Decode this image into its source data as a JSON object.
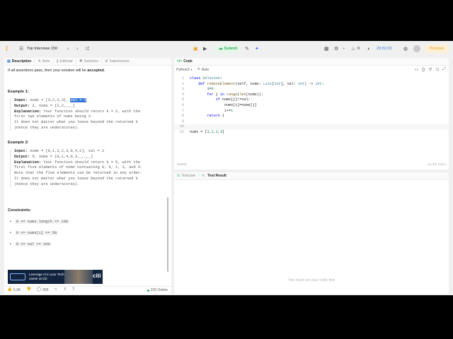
{
  "topnav": {
    "list_title": "Top Interview 150",
    "submit_label": "Submit",
    "fire_count": "0",
    "timer": "29:52:23",
    "premium_label": "Premium"
  },
  "left": {
    "tabs": [
      {
        "label": "Description"
      },
      {
        "label": "Note"
      },
      {
        "label": "Editorial"
      },
      {
        "label": "Solutions"
      },
      {
        "label": "Submissions"
      }
    ],
    "intro_text": "If all assertions pass, then your solution will be ",
    "intro_bold": "accepted",
    "intro_end": ".",
    "example1": {
      "title": "Example 1:",
      "input_label": "Input:",
      "input_value": " nums = [3,2,2,3], ",
      "input_hl": "val = 3",
      "output_label": "Output:",
      "output_value": " 2, nums = [2,2,_,_]",
      "explanation_label": "Explanation:",
      "explanation_lines": [
        " Your function should return k = 2, with the",
        "first two elements of nums being 2.",
        "It does not matter what you leave beyond the returned k",
        "(hence they are underscores)."
      ]
    },
    "example2": {
      "title": "Example 2:",
      "input_label": "Input:",
      "input_value": " nums = [0,1,2,2,3,0,4,2], val = 2",
      "output_label": "Output:",
      "output_value": " 5, nums = [0,1,4,0,3,_,_,_]",
      "explanation_label": "Explanation:",
      "explanation_lines": [
        " Your function should return k = 5, with the",
        "first five elements of nums containing 0, 0, 1, 3, and 4.",
        "Note that the five elements can be returned in any order.",
        "It does not matter what you leave beyond the returned k",
        "(hence they are underscores)."
      ]
    },
    "constraints_title": "Constraints:",
    "constraints": [
      "0 <= nums.length <= 100",
      "0 <= nums[i] <= 50",
      "0 <= val <= 100"
    ],
    "ad": {
      "text": "Leverage AI in your Tech career at Citi",
      "logo": "citi"
    },
    "footer": {
      "likes": "5.2K",
      "comments": "955",
      "online": "220 Online"
    }
  },
  "editor": {
    "title": "Code",
    "language": "Python3",
    "auto_label": "Auto",
    "lines": [
      {
        "n": "1",
        "html": "<span class='kw'>class</span> <span class='ty'>Solution</span>:"
      },
      {
        "n": "2",
        "html": "    <span class='kw'>def</span> <span class='fn'>removeElement</span>(self, nums: <span class='ty'>List</span>[<span class='ty'>int</span>], val: <span class='ty'>int</span>) -> <span class='ty'>int</span>:"
      },
      {
        "n": "3",
        "html": "        i=<span class='nm'>0</span>"
      },
      {
        "n": "4",
        "html": "        <span class='kw'>for</span> j <span class='kw'>in</span> <span class='fn'>range</span>(<span class='fn'>len</span>(nums)):"
      },
      {
        "n": "5",
        "html": "            <span class='kw'>if</span> nums[j]!=val:"
      },
      {
        "n": "6",
        "html": "                nums[i]=nums[j]"
      },
      {
        "n": "7",
        "html": "                i+=<span class='nm'>1</span>"
      },
      {
        "n": "8",
        "html": "        <span class='kw'>return</span> i"
      },
      {
        "n": "9",
        "html": ""
      },
      {
        "n": "10",
        "html": ""
      },
      {
        "n": "11",
        "html": "nums = [<span class='nm'>3</span>,<span class='nm'>2</span>,<span class='nm'>2</span>,<span class='nm'>3</span>]"
      }
    ],
    "saved_label": "Saved",
    "cursor_pos": "Ln 10, Col 1"
  },
  "result": {
    "tabs": [
      {
        "label": "Testcase"
      },
      {
        "label": "Test Result"
      }
    ],
    "message": "You must run your code first"
  }
}
